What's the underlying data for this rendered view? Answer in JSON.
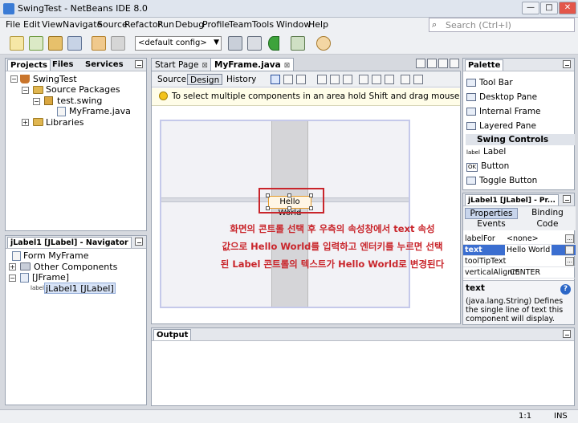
{
  "window": {
    "title": "SwingTest - NetBeans IDE 8.0",
    "minimize": "—",
    "maximize": "□",
    "close": "✕"
  },
  "menu": [
    "File",
    "Edit",
    "View",
    "Navigate",
    "Source",
    "Refactor",
    "Run",
    "Debug",
    "Profile",
    "Team",
    "Tools",
    "Window",
    "Help"
  ],
  "search": {
    "placeholder": "Search (Ctrl+I)"
  },
  "toolbar": {
    "config": "<default config>"
  },
  "projects_panel": {
    "tabs": [
      "Projects",
      "Files",
      "Services"
    ],
    "tree": [
      "SwingTest",
      "Source Packages",
      "test.swing",
      "MyFrame.java",
      "Libraries"
    ]
  },
  "navigator_panel": {
    "title": "jLabel1 [JLabel] - Navigator",
    "tree": [
      "Form MyFrame",
      "Other Components",
      "[JFrame]",
      "jLabel1 [JLabel]"
    ],
    "label_icon_text": "label"
  },
  "editor": {
    "tabs": [
      "Start Page",
      "MyFrame.java"
    ],
    "view_buttons": [
      "Source",
      "Design",
      "History"
    ],
    "hint": "To select multiple components in an area hold Shift and drag mouse over the com",
    "label_text": "Hello World"
  },
  "annotation": {
    "line1": "화면의 콘트롤 선택 후 우측의 속성창에서 text 속성",
    "line2": "값으로 Hello World를 입력하고 엔터키를 누르면 선택",
    "line3": "된 Label 콘트롤의 텍스트가 Hello World로 변경된다"
  },
  "palette": {
    "title": "Palette",
    "items_top": [
      "Tool Bar",
      "Desktop Pane",
      "Internal Frame",
      "Layered Pane"
    ],
    "section": "Swing Controls",
    "items_controls": [
      "Label",
      "Button",
      "Toggle Button"
    ],
    "icon_texts": {
      "label": "label",
      "button": "OK"
    }
  },
  "properties": {
    "title": "jLabel1 [JLabel] - Pr...",
    "tabs": [
      "Properties",
      "Binding",
      "Events",
      "Code"
    ],
    "rows": [
      {
        "name": "labelFor",
        "value": "<none>"
      },
      {
        "name": "text",
        "value": "Hello World"
      },
      {
        "name": "toolTipText",
        "value": ""
      },
      {
        "name": "verticalAlignm",
        "value": "CENTER"
      }
    ],
    "desc_title": "text",
    "desc_body": "(java.lang.String) Defines the single line of text this component will display."
  },
  "output_panel": {
    "title": "Output"
  },
  "status": {
    "position": "1:1",
    "mode": "INS"
  }
}
